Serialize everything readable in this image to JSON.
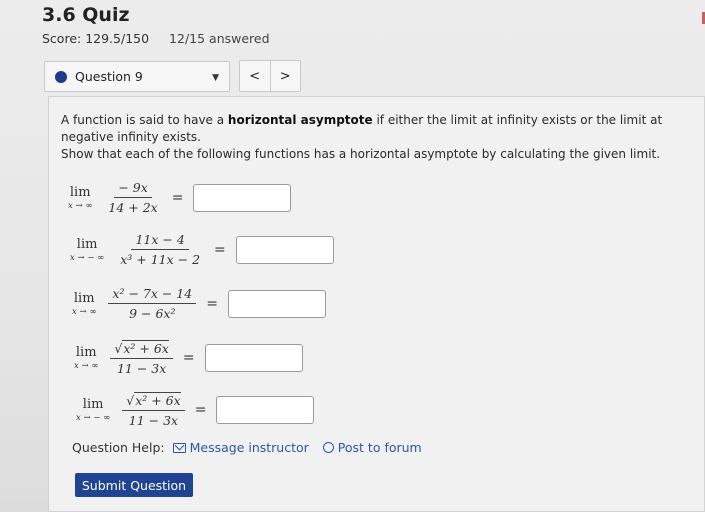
{
  "header": {
    "title": "3.6 Quiz",
    "score": "Score: 129.5/150",
    "answered": "12/15 answered"
  },
  "question_nav": {
    "label": "Question 9",
    "prev": "<",
    "next": ">"
  },
  "question": {
    "intro_part1": "A function is said to have a ",
    "intro_bold": "horizontal asymptote",
    "intro_part2": " if either the limit at infinity exists or the limit at negative infinity exists.",
    "instruction": "Show that each of the following functions has a horizontal asymptote by calculating the given limit.",
    "limits": [
      {
        "lim": "lim",
        "sub": "x → ∞",
        "num": "− 9x",
        "den": "14 + 2x",
        "value": ""
      },
      {
        "lim": "lim",
        "sub": "x → − ∞",
        "num": "11x − 4",
        "den": "x³ + 11x − 2",
        "value": ""
      },
      {
        "lim": "lim",
        "sub": "x → ∞",
        "num": "x² − 7x − 14",
        "den": "9 − 6x²",
        "value": ""
      },
      {
        "lim": "lim",
        "sub": "x → ∞",
        "num_radicand": "x² + 6x",
        "den": "11 − 3x",
        "value": ""
      },
      {
        "lim": "lim",
        "sub": "x → − ∞",
        "num_radicand": "x² + 6x",
        "den": "11 − 3x",
        "value": ""
      }
    ],
    "equals": "="
  },
  "help": {
    "label": "Question Help:",
    "message": "Message instructor",
    "forum": "Post to forum"
  },
  "submit_label": "Submit Question",
  "colors": {
    "accent": "#1f4496",
    "link": "#2b55b6",
    "selected_dot": "#1d3b8f"
  }
}
